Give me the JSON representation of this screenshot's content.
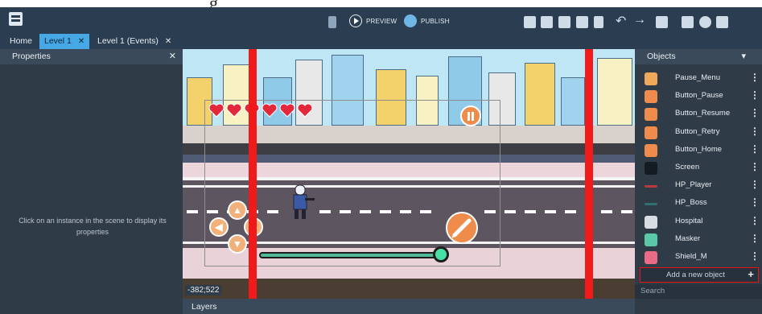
{
  "header_caption": "g",
  "toolbar": {
    "preview_label": "PREVIEW",
    "publish_label": "PUBLISH"
  },
  "tabs": [
    {
      "label": "Home",
      "active": false,
      "closable": false
    },
    {
      "label": "Level 1",
      "active": true,
      "closable": true
    },
    {
      "label": "Level 1 (Events)",
      "active": false,
      "closable": true
    }
  ],
  "properties_panel": {
    "title": "Properties",
    "hint": "Click on an instance in the scene to display its properties"
  },
  "scene": {
    "coords_readout": "-382;522"
  },
  "objects_panel": {
    "title": "Objects",
    "items": [
      {
        "name": "Pause_Menu",
        "icon": "folder-icon",
        "color": "#f0a85a"
      },
      {
        "name": "Button_Pause",
        "icon": "pause-icon",
        "color": "#ef8b4b"
      },
      {
        "name": "Button_Resume",
        "icon": "play-icon",
        "color": "#ef8b4b"
      },
      {
        "name": "Button_Retry",
        "icon": "retry-icon",
        "color": "#ef8b4b"
      },
      {
        "name": "Button_Home",
        "icon": "home-icon",
        "color": "#ef8b4b"
      },
      {
        "name": "Screen",
        "icon": "screen-icon",
        "color": "#151b22"
      },
      {
        "name": "HP_Player",
        "icon": "bar-icon",
        "color": "#b83a3a"
      },
      {
        "name": "HP_Boss",
        "icon": "bar-icon",
        "color": "#2f7070"
      },
      {
        "name": "Hospital",
        "icon": "building-icon",
        "color": "#d7dde3"
      },
      {
        "name": "Masker",
        "icon": "mask-icon",
        "color": "#59c9a8"
      },
      {
        "name": "Shield_M",
        "icon": "shield-icon",
        "color": "#e96b86"
      }
    ],
    "add_label": "Add a new object",
    "search_placeholder": "Search"
  },
  "layers_panel": {
    "title": "Layers"
  }
}
